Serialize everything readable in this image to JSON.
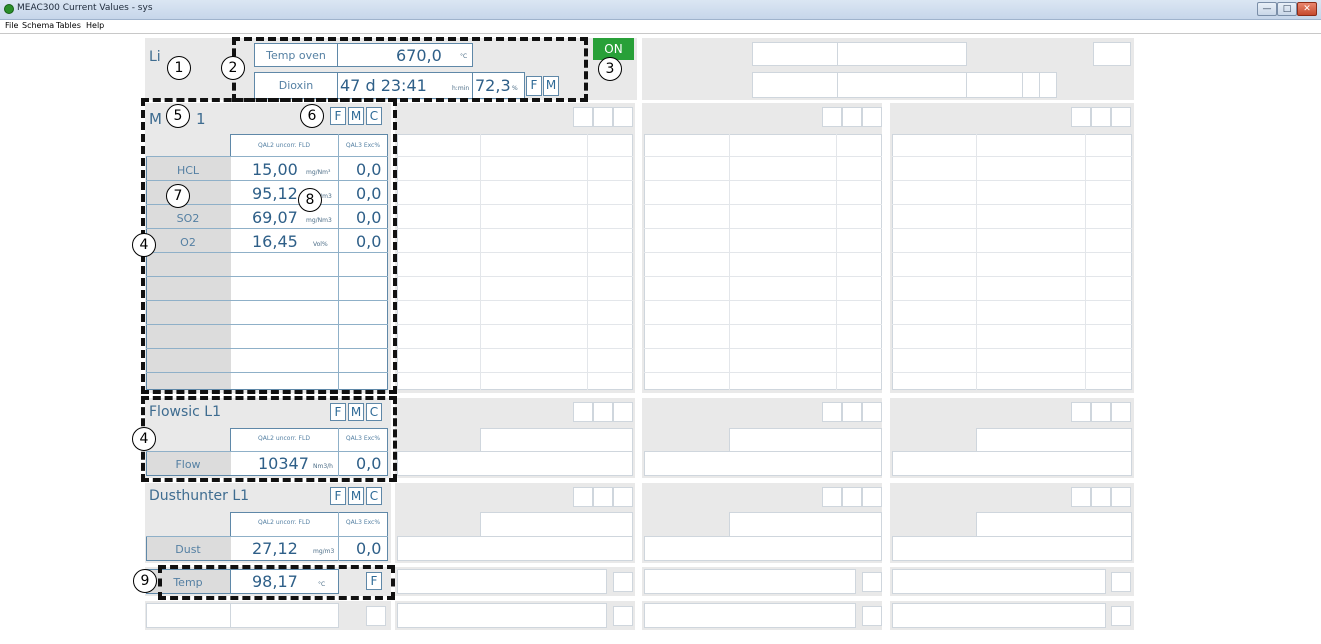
{
  "window": {
    "title": "MEAC300 Current Values - sys",
    "buttons": [
      "—",
      "□",
      "✕"
    ]
  },
  "menu": [
    "File",
    "Schema",
    "Tables",
    "Help"
  ],
  "line": {
    "title_partial": "Li",
    "status": "ON",
    "temp_oven": {
      "label": "Temp oven",
      "value": "670,0",
      "unit": "°C"
    },
    "dioxin": {
      "label": "Dioxin",
      "time": "47 d 23:41",
      "time_unit": "h:min",
      "pct": "72,3",
      "pct_unit": "%",
      "flags": [
        "F",
        "M"
      ]
    }
  },
  "column_headers": {
    "qal2": "QAL2 uncorr. FLD",
    "qal3": "QAL3 Exc%"
  },
  "analyzer": {
    "name_partial": "M",
    "name_suffix": "1",
    "flags": [
      "F",
      "M",
      "C"
    ],
    "rows": [
      {
        "name": "HCL",
        "value": "15,00",
        "unit": "mg/Nm³",
        "exc": "0,0"
      },
      {
        "name": "",
        "value": "95,12",
        "unit": "mg/Nm3",
        "exc": "0,0"
      },
      {
        "name": "SO2",
        "value": "69,07",
        "unit": "mg/Nm3",
        "exc": "0,0"
      },
      {
        "name": "O2",
        "value": "16,45",
        "unit": "Vol%",
        "exc": "0,0"
      }
    ]
  },
  "flowsic": {
    "name": "Flowsic L1",
    "flags": [
      "F",
      "M",
      "C"
    ],
    "row": {
      "name": "Flow",
      "value": "10347",
      "unit": "Nm3/h",
      "exc": "0,0"
    }
  },
  "dusthunter": {
    "name": "Dusthunter L1",
    "flags": [
      "F",
      "M",
      "C"
    ],
    "row": {
      "name": "Dust",
      "value": "27,12",
      "unit": "mg/m3",
      "exc": "0,0"
    },
    "temp": {
      "name": "Temp",
      "value": "98,17",
      "unit": "°C",
      "flag": "F"
    }
  },
  "callouts": [
    "1",
    "2",
    "3",
    "4",
    "5",
    "6",
    "7",
    "8",
    "4",
    "9"
  ]
}
